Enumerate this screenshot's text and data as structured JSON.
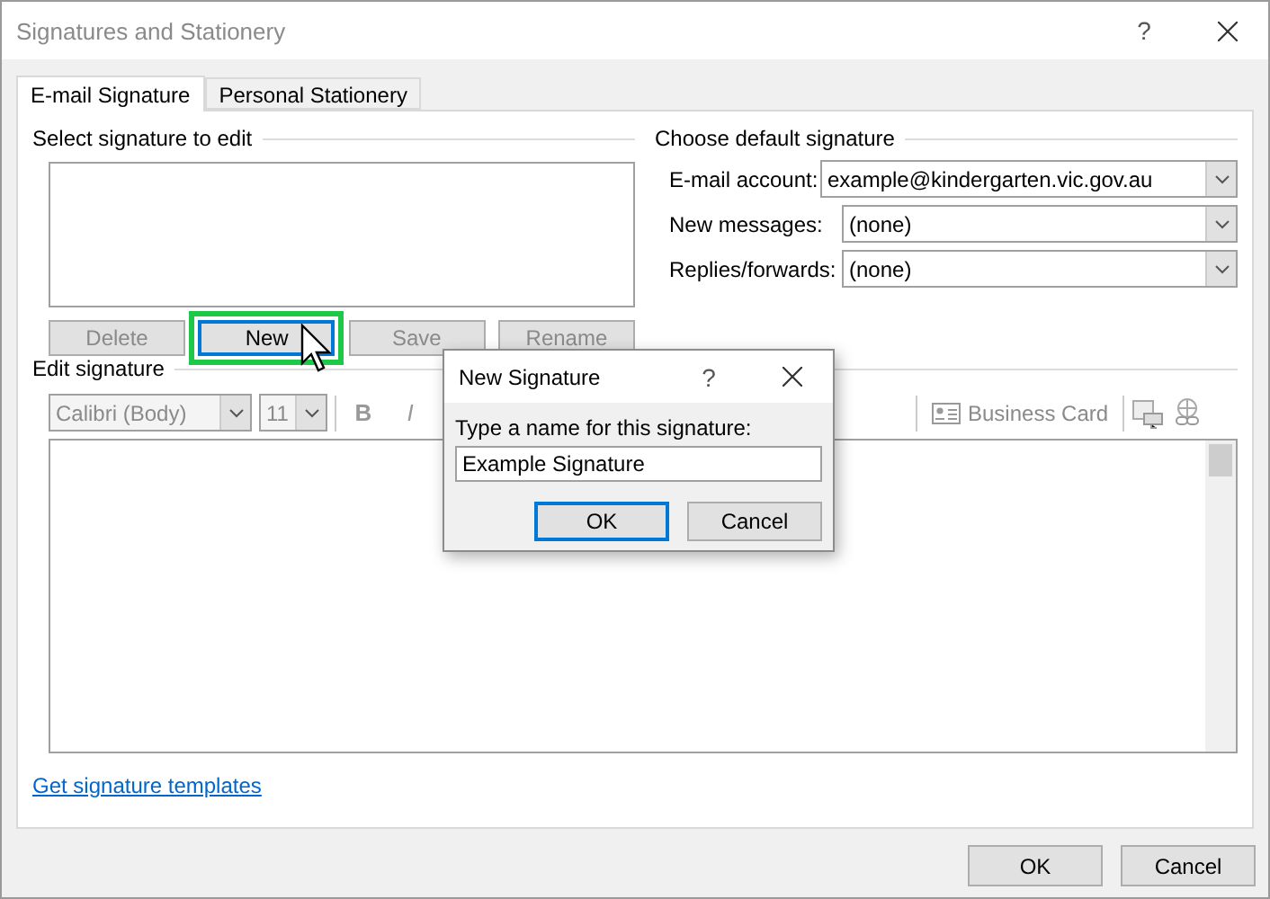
{
  "window": {
    "title": "Signatures and Stationery",
    "help": "?"
  },
  "tabs": [
    {
      "label": "E-mail Signature",
      "selected": true
    },
    {
      "label": "Personal Stationery",
      "selected": false
    }
  ],
  "select_section": {
    "heading": "Select signature to edit",
    "buttons": [
      {
        "label": "Delete",
        "disabled": true,
        "highlighted": false
      },
      {
        "label": "New",
        "disabled": false,
        "highlighted": true
      },
      {
        "label": "Save",
        "disabled": true,
        "highlighted": false
      },
      {
        "label": "Rename",
        "disabled": true,
        "highlighted": false
      }
    ]
  },
  "default_section": {
    "heading": "Choose default signature",
    "fields": [
      {
        "label": "E-mail account:",
        "value": "example@kindergarten.vic.gov.au"
      },
      {
        "label": "New messages:",
        "value": "(none)"
      },
      {
        "label": "Replies/forwards:",
        "value": "(none)"
      }
    ]
  },
  "edit_section": {
    "heading": "Edit signature",
    "font": "Calibri (Body)",
    "size": "11",
    "bold": "B",
    "italic": "I",
    "business_card": "Business Card"
  },
  "link": "Get signature templates",
  "footer_buttons": [
    "OK",
    "Cancel"
  ],
  "popup": {
    "title": "New Signature",
    "help": "?",
    "prompt": "Type a name for this signature:",
    "value": "Example Signature",
    "buttons": [
      {
        "label": "OK",
        "default": true
      },
      {
        "label": "Cancel",
        "default": false
      }
    ]
  }
}
